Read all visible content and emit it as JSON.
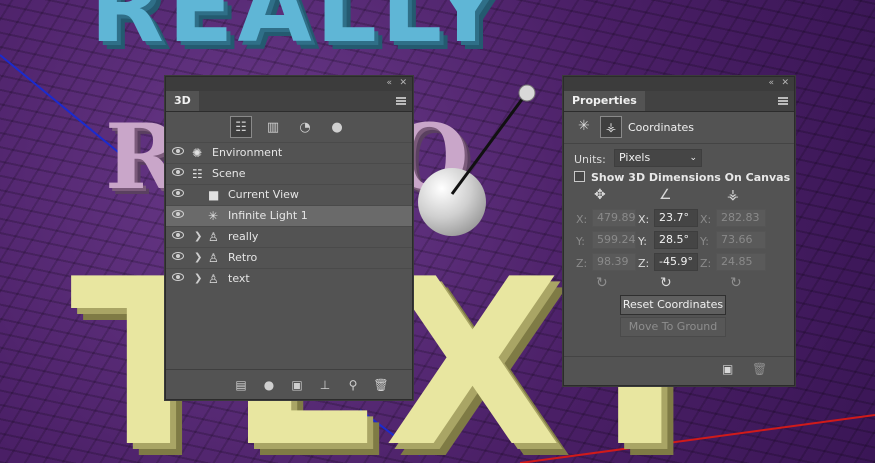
{
  "panel3d": {
    "title": "3D",
    "filter_icons": [
      "scene-filter-icon",
      "mesh-filter-icon",
      "material-filter-icon",
      "light-filter-icon"
    ],
    "items": [
      {
        "label": "Environment",
        "icon": "environment-icon",
        "expandable": false,
        "selected": false
      },
      {
        "label": "Scene",
        "icon": "scene-icon",
        "expandable": false,
        "selected": false
      },
      {
        "label": "Current View",
        "icon": "camera-icon",
        "expandable": false,
        "selected": false
      },
      {
        "label": "Infinite Light 1",
        "icon": "light-icon",
        "expandable": false,
        "selected": true
      },
      {
        "label": "really",
        "icon": "mesh-icon",
        "expandable": true,
        "selected": false
      },
      {
        "label": "Retro",
        "icon": "mesh-icon",
        "expandable": true,
        "selected": false
      },
      {
        "label": "text",
        "icon": "mesh-icon",
        "expandable": true,
        "selected": false
      }
    ],
    "bottom_icons": [
      "render-icon",
      "add-light-icon",
      "new-view-icon",
      "ground-icon",
      "camera-move-icon",
      "delete-icon"
    ]
  },
  "properties": {
    "title": "Properties",
    "section": "Coordinates",
    "units_label": "Units:",
    "units_value": "Pixels",
    "show_dims_label": "Show 3D Dimensions On Canvas",
    "position": {
      "x": "479.89",
      "y": "599.24",
      "z": "98.39"
    },
    "rotation": {
      "x": "23.7°",
      "y": "28.5°",
      "z": "-45.9°"
    },
    "scale": {
      "x": "282.83",
      "y": "73.66",
      "z": "24.85"
    },
    "axis_labels": {
      "x": "X:",
      "y": "Y:",
      "z": "Z:"
    },
    "reset_button": "Reset Coordinates",
    "ground_button": "Move To Ground"
  },
  "scene": {
    "word_top": "REALLY",
    "word_mid": "RETRO",
    "word_bottom": "TEXT"
  },
  "colors": {
    "canvas_bg": "#4a1f66",
    "letters_top": "#5fb6d6",
    "letters_mid": "#c9a6c9",
    "letters_bottom": "#e8e6a0",
    "panel_bg": "#535353"
  }
}
